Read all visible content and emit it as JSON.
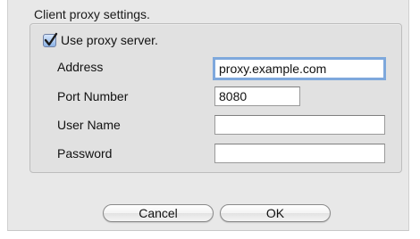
{
  "group": {
    "title": "Client proxy settings."
  },
  "proxy": {
    "use_label": "Use proxy server.",
    "checked": true
  },
  "fields": {
    "address_label": "Address",
    "address_value": "proxy.example.com",
    "port_label": "Port Number",
    "port_value": "8080",
    "username_label": "User Name",
    "username_value": "",
    "password_label": "Password",
    "password_value": ""
  },
  "buttons": {
    "cancel_label": "Cancel",
    "ok_label": "OK"
  },
  "colors": {
    "focus_ring": "#7ea8dc",
    "checkbox_fill": "#8cb3e6"
  }
}
